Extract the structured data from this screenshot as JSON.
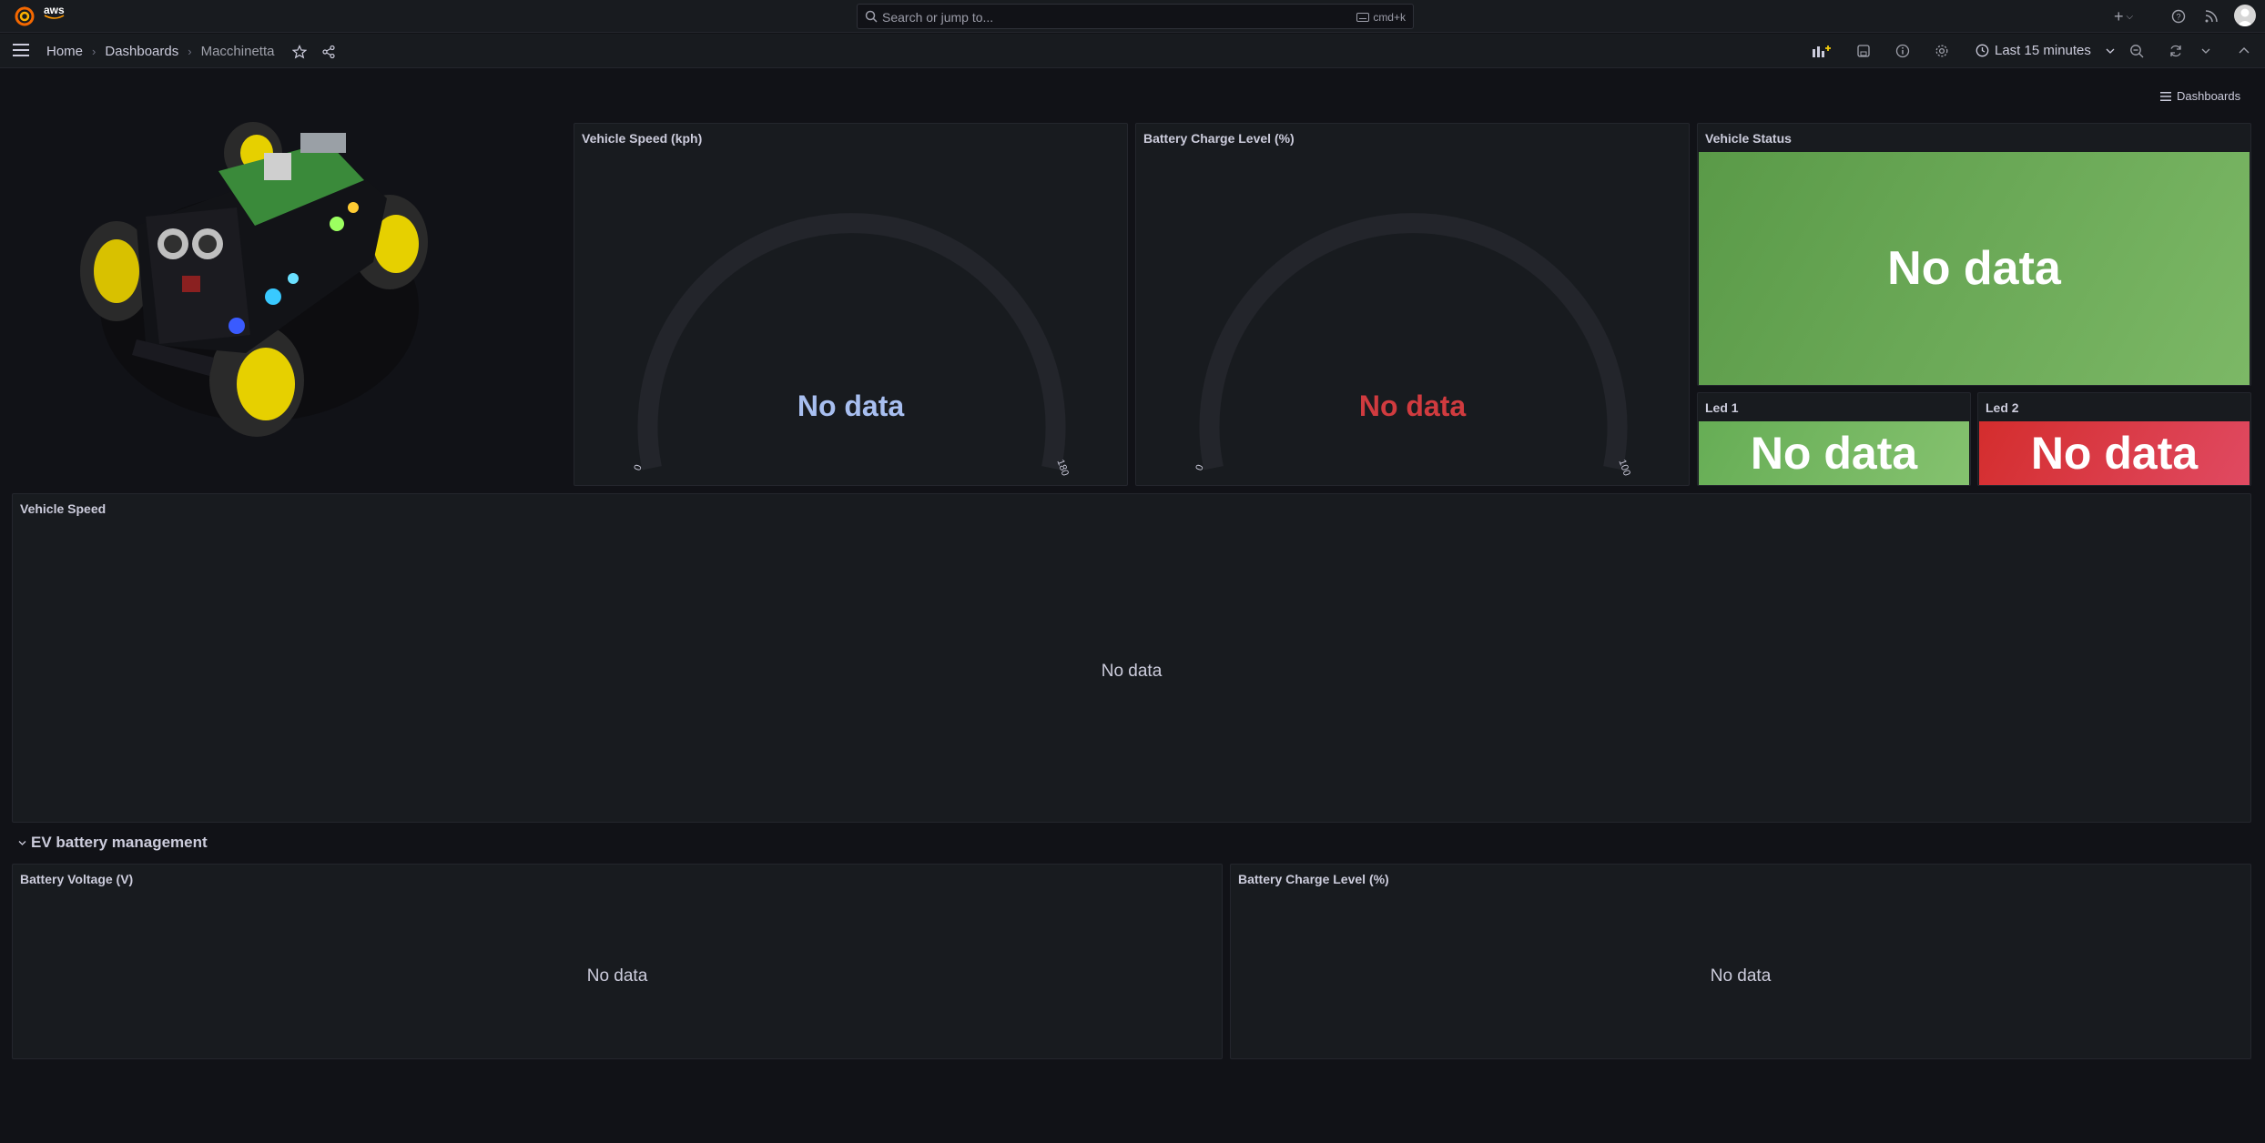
{
  "topbar": {
    "brand": "aws",
    "search_placeholder": "Search or jump to...",
    "search_shortcut": "cmd+k"
  },
  "breadcrumb": {
    "home": "Home",
    "dashboards": "Dashboards",
    "current": "Macchinetta"
  },
  "toolbar": {
    "time_range": "Last 15 minutes"
  },
  "dashboards_link": "Dashboards",
  "panels": {
    "vehicle_speed_gauge": {
      "title": "Vehicle Speed (kph)",
      "value": "No data",
      "min": "0",
      "max": "180",
      "value_color": "#a8bff0"
    },
    "battery_gauge": {
      "title": "Battery Charge Level (%)",
      "value": "No data",
      "min": "0",
      "max": "100",
      "value_color": "#d03b3f"
    },
    "vehicle_status": {
      "title": "Vehicle Status",
      "value": "No data",
      "color": "#6da856"
    },
    "led1": {
      "title": "Led 1",
      "value": "No data",
      "color": "#73bf69"
    },
    "led2": {
      "title": "Led 2",
      "value": "No data",
      "color": "#e02f44"
    },
    "vehicle_speed_ts": {
      "title": "Vehicle Speed",
      "value": "No data"
    },
    "battery_voltage": {
      "title": "Battery Voltage (V)",
      "value": "No data"
    },
    "battery_charge_ts": {
      "title": "Battery Charge Level (%)",
      "value": "No data"
    }
  },
  "row": {
    "title": "EV battery management"
  }
}
